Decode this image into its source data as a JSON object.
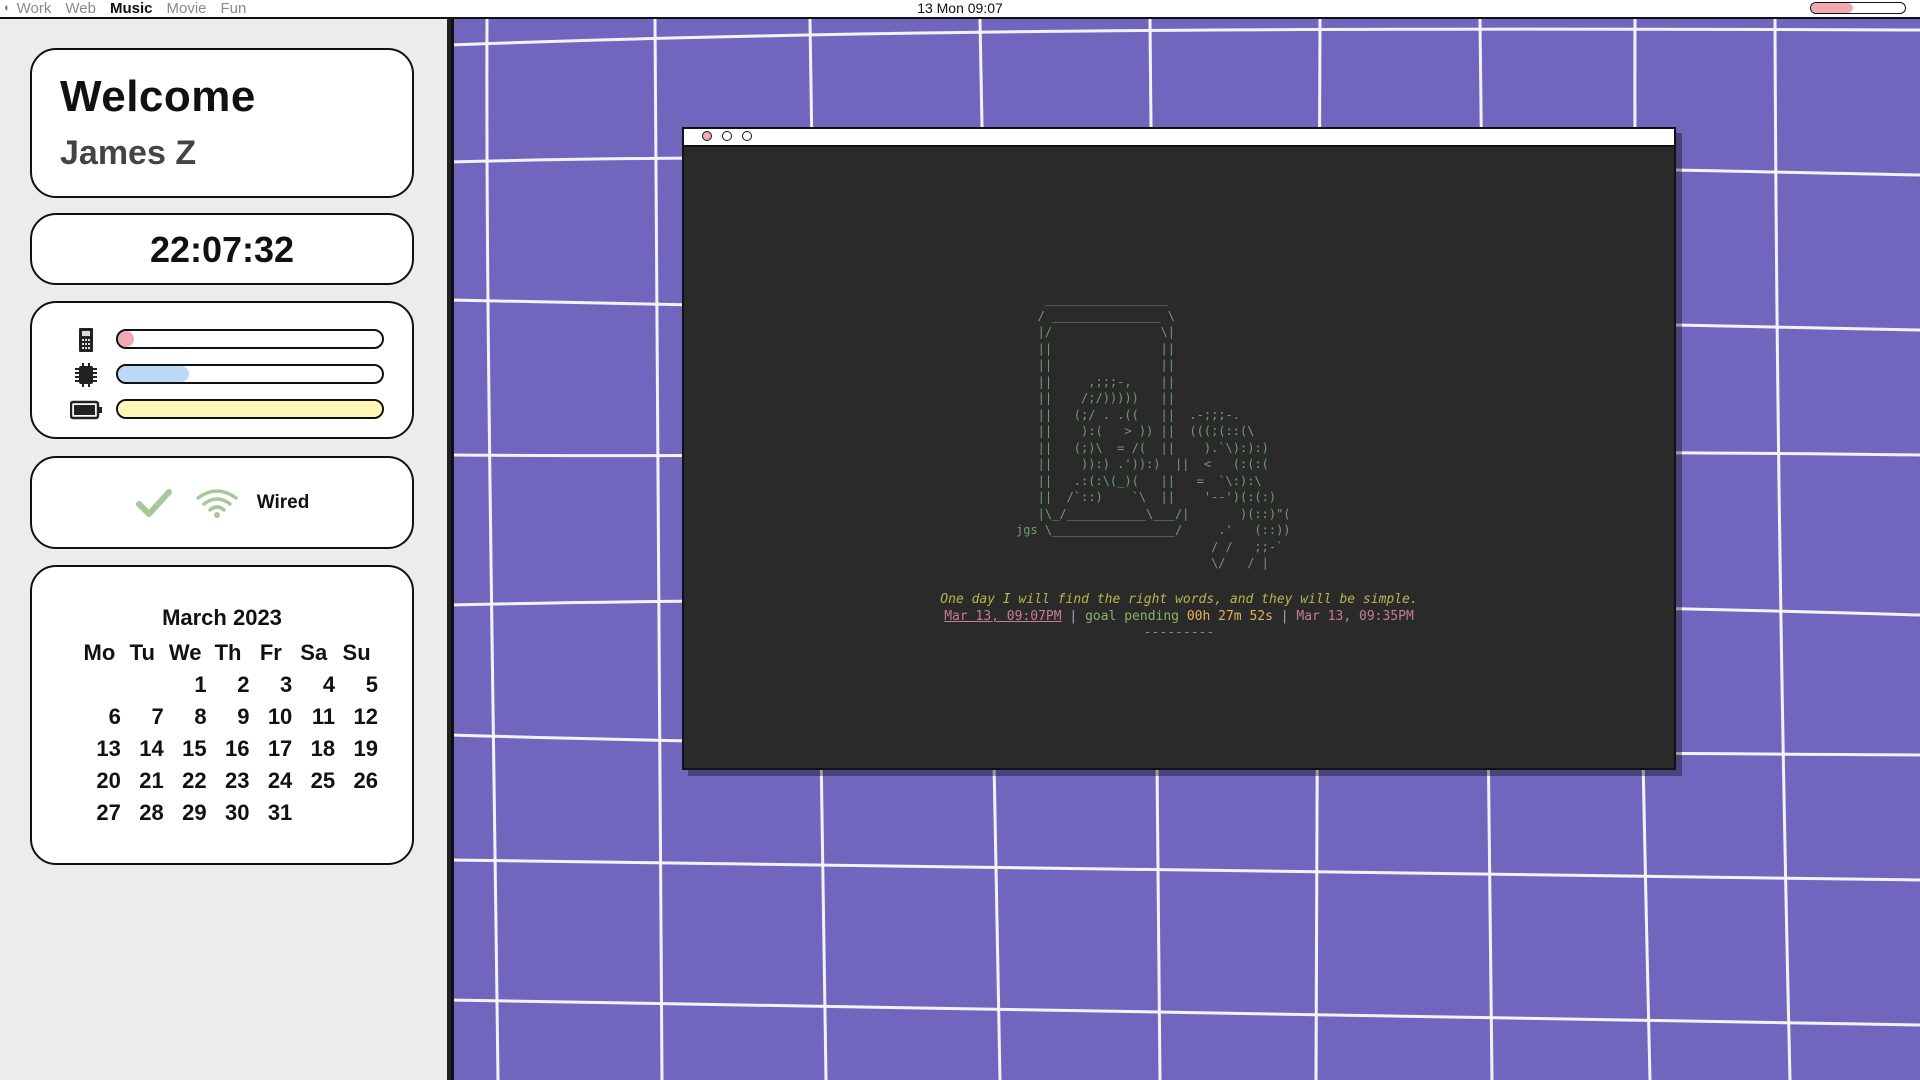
{
  "topbar": {
    "workspaces": [
      "Work",
      "Web",
      "Music",
      "Movie",
      "Fun"
    ],
    "active_workspace": "Music",
    "clock": "13  Mon 09:07",
    "volume_fraction": 0.45,
    "volume_color": "#f1a9b4"
  },
  "sidebar": {
    "welcome_title": "Welcome",
    "user_name": "James Z",
    "time": "22:07:32",
    "stats": [
      {
        "icon": "memory-icon",
        "fraction": 0.05,
        "color": "#f1a9b4"
      },
      {
        "icon": "cpu-icon",
        "fraction": 0.27,
        "color": "#b9d9f5"
      },
      {
        "icon": "battery-icon",
        "fraction": 1.0,
        "color": "#fdf6b5"
      }
    ],
    "network": {
      "status_icon": "checkmark-icon",
      "wifi_icon": "wifi-icon",
      "label": "Wired",
      "accent": "#a5c79b"
    },
    "calendar": {
      "title": "March 2023",
      "weekdays": [
        "Mo",
        "Tu",
        "We",
        "Th",
        "Fr",
        "Sa",
        "Su"
      ],
      "weeks": [
        [
          "",
          "",
          "1",
          "2",
          "3",
          "4",
          "5"
        ],
        [
          "6",
          "7",
          "8",
          "9",
          "10",
          "11",
          "12"
        ],
        [
          "13",
          "14",
          "15",
          "16",
          "17",
          "18",
          "19"
        ],
        [
          "20",
          "21",
          "22",
          "23",
          "24",
          "25",
          "26"
        ],
        [
          "27",
          "28",
          "29",
          "30",
          "31",
          "",
          ""
        ]
      ],
      "today": "13"
    }
  },
  "terminal": {
    "ascii_art": "    _________________\n   / _______________ \\\n   |/               \\|\n   ||               ||\n   ||               ||\n   ||     ,;;;-,    ||\n   ||    /;/)))))   ||\n   ||   (;/ . .((   ||  .-;;;-.\n   ||    ):(   > )) ||  (((;(::(\\\n   ||   (;)\\  = /(  ||    ).`\\):):)\n   ||    )):) .')):)  ||  <   (:(:(\n   ||   .:(:\\(_)(   ||   =  `\\:):\\\n   ||  /`::)    `\\  ||    '--')(:(:)\n   |\\_/___________\\___/|       )(::)\"(\njgs \\_________________/     .'   (::))\n                           / /   ;;-`\n                           \\/   / |",
    "quote": "One day I will find the right words, and they will be simple.",
    "goal_start": "Mar 13, 09:07PM",
    "goal_status": "goal pending",
    "goal_remaining": "00h 27m 52s",
    "goal_end": "Mar 13, 09:35PM",
    "goal_separator": "|",
    "dashes": "---------"
  }
}
